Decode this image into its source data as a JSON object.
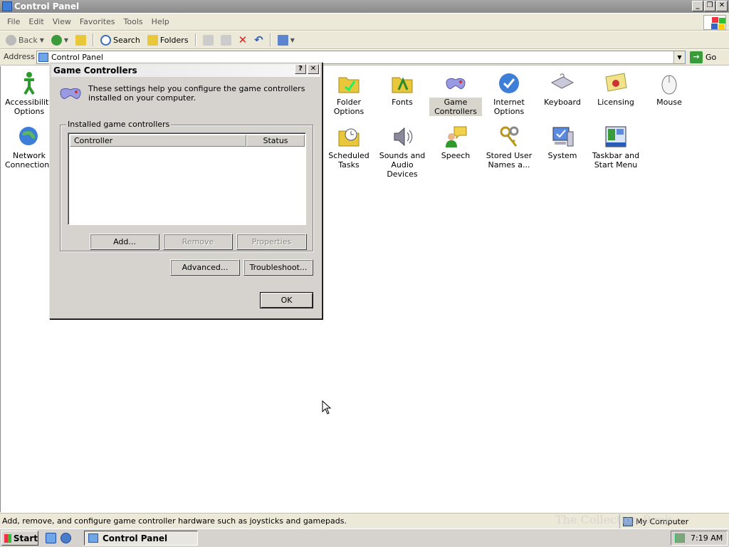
{
  "window": {
    "title": "Control Panel"
  },
  "menu": [
    "File",
    "Edit",
    "View",
    "Favorites",
    "Tools",
    "Help"
  ],
  "toolbar": {
    "back": "Back",
    "search": "Search",
    "folders": "Folders"
  },
  "address": {
    "label": "Address",
    "value": "Control Panel",
    "go": "Go"
  },
  "items": [
    {
      "label": "Accessibility Options"
    },
    {
      "label": "Network Connections"
    },
    {
      "label": "Folder Options"
    },
    {
      "label": "Fonts"
    },
    {
      "label": "Game Controllers"
    },
    {
      "label": "Internet Options"
    },
    {
      "label": "Keyboard"
    },
    {
      "label": "Licensing"
    },
    {
      "label": "Mouse"
    },
    {
      "label": "Scheduled Tasks"
    },
    {
      "label": "Sounds and Audio Devices"
    },
    {
      "label": "Speech"
    },
    {
      "label": "Stored User Names a..."
    },
    {
      "label": "System"
    },
    {
      "label": "Taskbar and Start Menu"
    }
  ],
  "dialog": {
    "title": "Game Controllers",
    "intro": "These settings help you configure the game controllers installed on your computer.",
    "group_label": "Installed game controllers",
    "columns": [
      "Controller",
      "Status"
    ],
    "add": "Add...",
    "remove": "Remove",
    "properties": "Properties",
    "advanced": "Advanced...",
    "troubleshoot": "Troubleshoot...",
    "ok": "OK"
  },
  "status": {
    "text": "Add, remove, and configure game controller hardware such as joysticks and gamepads.",
    "zone": "My Computer"
  },
  "taskbar": {
    "start": "Start",
    "task": "Control Panel",
    "clock": "7:19 AM"
  },
  "watermark": "The Collection Book"
}
